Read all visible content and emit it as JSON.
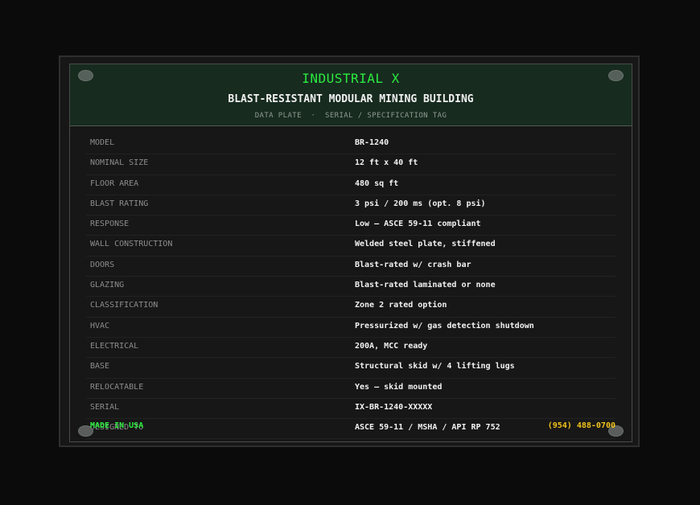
{
  "header": {
    "brand": "INDUSTRIAL X",
    "product": "BLAST-RESISTANT MODULAR MINING BUILDING",
    "subtitle": "DATA PLATE  ·  SERIAL / SPECIFICATION TAG"
  },
  "specs": [
    {
      "label": "MODEL",
      "value": "BR-1240"
    },
    {
      "label": "NOMINAL SIZE",
      "value": "12 ft x 40 ft"
    },
    {
      "label": "FLOOR AREA",
      "value": "480 sq ft"
    },
    {
      "label": "BLAST RATING",
      "value": "3 psi / 200 ms (opt. 8 psi)"
    },
    {
      "label": "RESPONSE",
      "value": "Low — ASCE 59-11 compliant"
    },
    {
      "label": "WALL CONSTRUCTION",
      "value": "Welded steel plate, stiffened"
    },
    {
      "label": "DOORS",
      "value": "Blast-rated w/ crash bar"
    },
    {
      "label": "GLAZING",
      "value": "Blast-rated laminated or none"
    },
    {
      "label": "CLASSIFICATION",
      "value": "Zone 2 rated option"
    },
    {
      "label": "HVAC",
      "value": "Pressurized w/ gas detection shutdown"
    },
    {
      "label": "ELECTRICAL",
      "value": "200A, MCC ready"
    },
    {
      "label": "BASE",
      "value": "Structural skid w/ 4 lifting lugs"
    },
    {
      "label": "RELOCATABLE",
      "value": "Yes — skid mounted"
    },
    {
      "label": "SERIAL",
      "value": "IX-BR-1240-XXXXX"
    },
    {
      "label": "DESIGNED TO",
      "value": "ASCE 59-11 / MSHA / API RP 752"
    }
  ],
  "footer": {
    "origin": "MADE IN USA",
    "phone": "(954) 488-0700"
  },
  "colors": {
    "brand_green": "#2bea3f",
    "phone_yellow": "#f2c21b",
    "header_bg": "#172b1f"
  }
}
